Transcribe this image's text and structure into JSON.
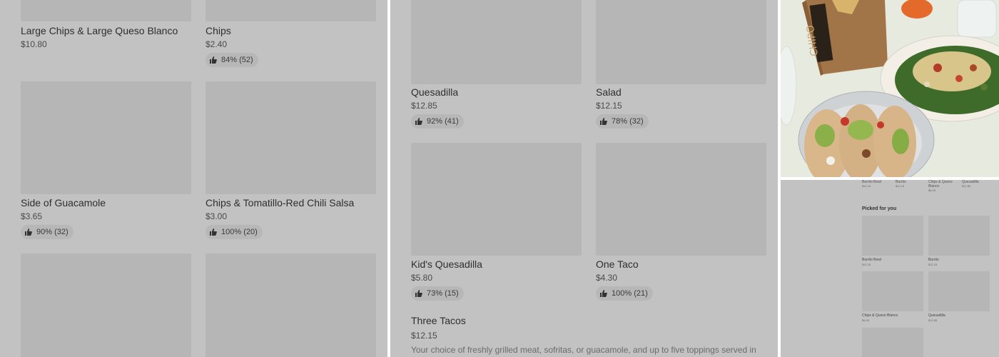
{
  "left_panel": {
    "items": [
      {
        "name": "Large Chips & Large Queso Blanco",
        "price": "$10.80",
        "rating": ""
      },
      {
        "name": "Chips",
        "price": "$2.40",
        "rating": "84% (52)"
      },
      {
        "name": "Side of Guacamole",
        "price": "$3.65",
        "rating": "90% (32)"
      },
      {
        "name": "Chips & Tomatillo-Red Chili Salsa",
        "price": "$3.00",
        "rating": "100% (20)"
      }
    ]
  },
  "mid_panel": {
    "items": [
      {
        "name": "Quesadilla",
        "price": "$12.85",
        "rating": "92% (41)"
      },
      {
        "name": "Salad",
        "price": "$12.15",
        "rating": "78% (32)"
      },
      {
        "name": "Kid's Quesadilla",
        "price": "$5.80",
        "rating": "73% (15)"
      },
      {
        "name": "One Taco",
        "price": "$4.30",
        "rating": "100% (21)"
      }
    ],
    "feature": {
      "name": "Three Tacos",
      "price": "$12.15",
      "description": "Your choice of freshly grilled meat, sofritas, or guacamole, and up to five toppings served in"
    }
  },
  "photo_panel": {
    "bag_text": "CHIPO"
  },
  "mini_panel": {
    "top_items": [
      {
        "name": "Burrito Bowl",
        "price": "$12.15"
      },
      {
        "name": "Burrito",
        "price": "$12.15"
      },
      {
        "name": "Chips & Queso Blanco",
        "price": "$6.05"
      },
      {
        "name": "Quesadilla",
        "price": "$12.85"
      }
    ],
    "section_title": "Picked for you",
    "cards": [
      {
        "name": "Burrito Bowl",
        "price": "$12.15"
      },
      {
        "name": "Burrito",
        "price": "$12.15"
      },
      {
        "name": "Chips & Queso Blanco",
        "price": "$6.05"
      },
      {
        "name": "Quesadilla",
        "price": "$12.85"
      }
    ]
  },
  "colors": {
    "overlay": "#c2c2c2",
    "thumb": "#b6b6b6",
    "chip": "#b7b7b7"
  }
}
